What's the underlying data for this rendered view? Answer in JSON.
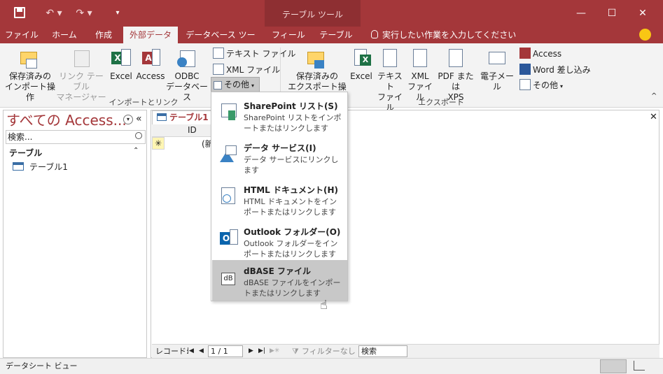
{
  "titlebar": {
    "contextual_label": "テーブル ツール"
  },
  "tabs": [
    "ファイル",
    "ホーム",
    "作成",
    "外部データ",
    "データベース ツール",
    "フィールド",
    "テーブル"
  ],
  "tell_me": "実行したい作業を入力してください",
  "ribbon": {
    "import_group": {
      "saved_imports": "保存済みの\nインポート操作",
      "linked_table_manager": "リンク テーブル\nマネージャー",
      "excel": "Excel",
      "access": "Access",
      "odbc": "ODBC\nデータベース",
      "text_file": "テキスト ファイル",
      "xml_file": "XML ファイル",
      "more": "その他",
      "label": "インポートとリンク"
    },
    "export_group": {
      "saved_exports": "保存済みの\nエクスポート操作",
      "excel": "Excel",
      "text_file": "テキスト\nファイル",
      "xml_file": "XML\nファイル",
      "pdf_xps": "PDF または\nXPS",
      "email": "電子メール",
      "access": "Access",
      "word_merge": "Word 差し込み",
      "more": "その他",
      "label": "エクスポート"
    }
  },
  "nav": {
    "title": "すべての Access...",
    "search_placeholder": "検索...",
    "section": "テーブル",
    "items": [
      "テーブル1"
    ]
  },
  "document": {
    "tab_label": "テーブル1",
    "column_header": "ID",
    "new_row_value": "(新"
  },
  "record_nav": {
    "label": "レコード:",
    "position": "1 / 1",
    "filter": "フィルターなし",
    "search": "検索"
  },
  "status": {
    "view": "データシート ビュー"
  },
  "menu": {
    "items": [
      {
        "title": "SharePoint リスト(S)",
        "desc": "SharePoint リストをインポートまたはリンクします"
      },
      {
        "title": "データ サービス(I)",
        "desc": "データ サービスにリンクします"
      },
      {
        "title": "HTML ドキュメント(H)",
        "desc": "HTML ドキュメントをインポートまたはリンクします"
      },
      {
        "title": "Outlook フォルダー(O)",
        "desc": "Outlook フォルダーをインポートまたはリンクします"
      },
      {
        "title": "dBASE ファイル",
        "desc": "dBASE ファイルをインポートまたはリンクします"
      }
    ]
  },
  "colors": {
    "accent": "#a4373a",
    "contextual": "#8e2f32",
    "ribbon_bg": "#f3f3f3",
    "hover": "#c8c8c8"
  }
}
